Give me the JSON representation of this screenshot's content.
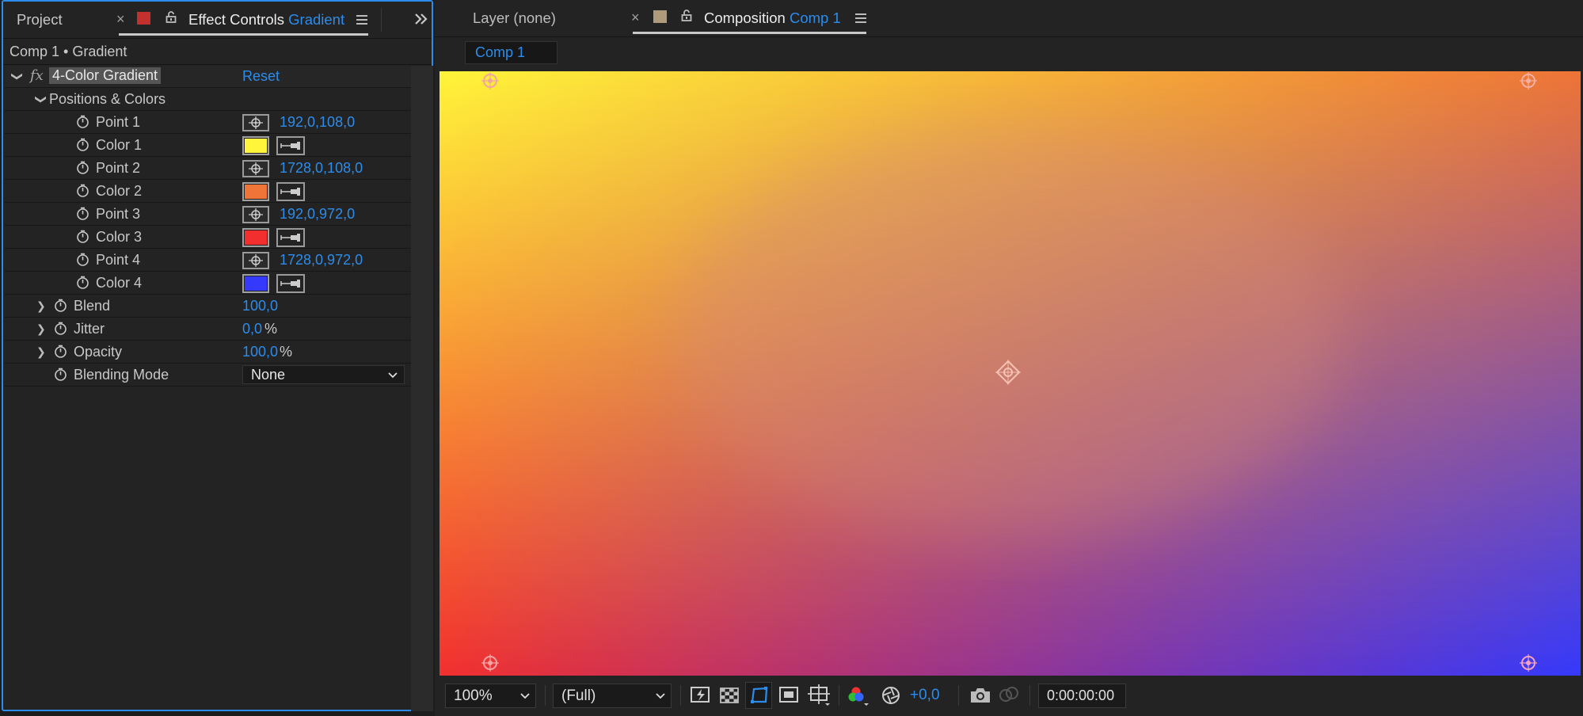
{
  "left_panel": {
    "tab_project": "Project",
    "tab_effect_controls_prefix": "Effect Controls",
    "tab_effect_controls_layer": "Gradient",
    "breadcrumb": "Comp 1 • Gradient",
    "effect": {
      "fx": "fx",
      "name": "4-Color Gradient",
      "reset": "Reset",
      "group": "Positions & Colors",
      "properties": [
        {
          "label": "Point 1",
          "value": "192,0,108,0",
          "type": "point"
        },
        {
          "label": "Color 1",
          "color": "#fff53a",
          "type": "color"
        },
        {
          "label": "Point 2",
          "value": "1728,0,108,0",
          "type": "point"
        },
        {
          "label": "Color 2",
          "color": "#ee7437",
          "type": "color"
        },
        {
          "label": "Point 3",
          "value": "192,0,972,0",
          "type": "point"
        },
        {
          "label": "Color 3",
          "color": "#f22f2e",
          "type": "color"
        },
        {
          "label": "Point 4",
          "value": "1728,0,972,0",
          "type": "point"
        },
        {
          "label": "Color 4",
          "color": "#3439fb",
          "type": "color"
        }
      ],
      "blend": {
        "label": "Blend",
        "value": "100,0"
      },
      "jitter": {
        "label": "Jitter",
        "value": "0,0",
        "unit": "%"
      },
      "opacity": {
        "label": "Opacity",
        "value": "100,0",
        "unit": "%"
      },
      "blending_mode": {
        "label": "Blending Mode",
        "value": "None"
      }
    }
  },
  "right_panel": {
    "tab_layer": "Layer (none)",
    "tab_composition_prefix": "Composition",
    "tab_composition_name": "Comp 1",
    "comp_tab": "Comp 1",
    "toolbar": {
      "zoom": "100%",
      "resolution": "(Full)",
      "exposure": "+0,0",
      "timecode": "0:00:00:00"
    }
  },
  "colors": {
    "accent": "#2d8ceb",
    "gradient_top_left": "#fff53a",
    "gradient_top_right": "#ee7437",
    "gradient_bottom_left": "#f22f2e",
    "gradient_bottom_right": "#3439fb"
  },
  "icons": [
    "close-icon",
    "lock-icon",
    "panel-menu-icon",
    "expand-panels-icon",
    "stopwatch-icon",
    "chevron-right-icon",
    "chevron-down-icon",
    "crosshair-icon",
    "eyedropper-icon",
    "fast-previews-icon",
    "transparency-grid-icon",
    "mask-visibility-icon",
    "region-of-interest-icon",
    "guides-icon",
    "color-channels-icon",
    "exposure-reset-icon",
    "snapshot-icon",
    "show-snapshot-icon"
  ]
}
